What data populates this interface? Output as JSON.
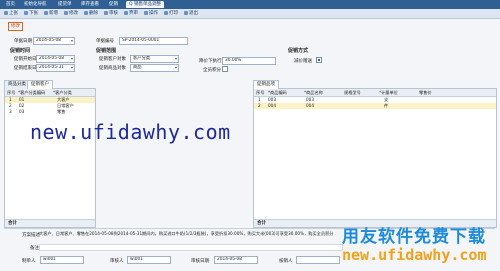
{
  "tabs": [
    "首页",
    "初始化导航",
    "提货单",
    "库存查看",
    "促销",
    "Q 销售单品调整"
  ],
  "toolbar": [
    "上张",
    "下张",
    "新增",
    "修改",
    "删除",
    "审核",
    "弃审",
    "操作",
    "打印",
    "退出"
  ],
  "title_badge": "修改",
  "header": {
    "doc_date_label": "单据日期",
    "doc_date": "2014-05-08",
    "doc_no_label": "单据编号",
    "doc_no": "SP-2014-05-0001",
    "time_group": "促销时间",
    "start_label": "促销开始日期",
    "start_date": "2014-05-08",
    "end_label": "促销结束日期",
    "end_date": "2014-05-31",
    "range_group": "促销范围",
    "customer_obj_label": "促销客户对象",
    "customer_obj": "客户分类",
    "goods_obj_label": "促销商品对象",
    "goods_obj": "商品",
    "price_ratio_label": "降价下执行",
    "price_ratio": "30.00%",
    "all_points_label": "全员积分",
    "method_group": "促销方式",
    "discount_label": "减价赠送"
  },
  "left_grid": {
    "tabs": [
      "商品分类",
      "促销客户"
    ],
    "columns": [
      "序号",
      "*客户分类编码",
      "*客户分类"
    ],
    "rows": [
      {
        "no": "1",
        "code": "01",
        "name": "大客户"
      },
      {
        "no": "2",
        "code": "02",
        "name": "日常客户"
      },
      {
        "no": "3",
        "code": "03",
        "name": "零售"
      }
    ],
    "footer": "合计"
  },
  "right_grid": {
    "title": "促销品项",
    "columns": [
      "序号",
      "*商品编码",
      "*商品名称",
      "规格型号",
      "*计量单位",
      "零售价"
    ],
    "rows": [
      {
        "no": "1",
        "code": "003",
        "name": "003",
        "spec": "",
        "unit": "支",
        "price": ""
      },
      {
        "no": "2",
        "code": "004",
        "name": "004",
        "spec": "",
        "unit": "件",
        "price": ""
      }
    ],
    "footer": "合计"
  },
  "bottom": {
    "desc_label": "方案描述",
    "desc": "大客户、日常客户、零售在2014-05-08到2014-05-31期间内，购买进口牛奶(1/2/3瓶装)，享受折扣30.00%，购买大米(003)可享受30.00%，购买全员积分",
    "remark_label": "备注",
    "maker_label": "制单人",
    "maker": "wi001",
    "auditor_label": "审核人",
    "auditor": "wi001",
    "audit_date_label": "审核日期",
    "audit_date": "2014-05-08",
    "closer_label": "核销人"
  },
  "watermarks": {
    "url1": "new.ufidawhy.com",
    "cn": "用友软件免费下载",
    "url2": "new.ufidawhy.com"
  }
}
